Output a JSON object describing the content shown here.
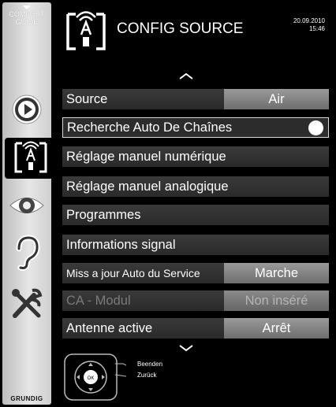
{
  "sidebar": {
    "guide_line1": "COMFORT",
    "guide_line2": "GUIDE",
    "brand": "GRUNDIG",
    "icons": [
      "play-icon",
      "source-antenna-icon",
      "eye-icon",
      "ear-icon",
      "tools-icon"
    ]
  },
  "header": {
    "title": "CONFIG SOURCE",
    "date": "20.09.2010",
    "time": "15:46"
  },
  "menu": {
    "items": [
      {
        "label": "Source",
        "value": "Air"
      },
      {
        "label": "Recherche Auto De Chaînes",
        "value": ""
      },
      {
        "label": "Réglage manuel numérique",
        "value": ""
      },
      {
        "label": "Réglage manuel analogique",
        "value": ""
      },
      {
        "label": "Programmes",
        "value": ""
      },
      {
        "label": "Informations signal",
        "value": ""
      },
      {
        "label": "Miss a jour Auto du Service",
        "value": "Marche"
      },
      {
        "label": "CA - Modul",
        "value": "Non inséré"
      },
      {
        "label": "Antenne active",
        "value": "Arrêt"
      }
    ]
  },
  "footer": {
    "help_exit": "Beenden",
    "help_back": "Zurück",
    "ok_label": "OK"
  },
  "colors": {
    "background": "#000000",
    "row": "#333333",
    "value_box": "#8a8a8a",
    "sidebar": "#d9d9d9"
  }
}
